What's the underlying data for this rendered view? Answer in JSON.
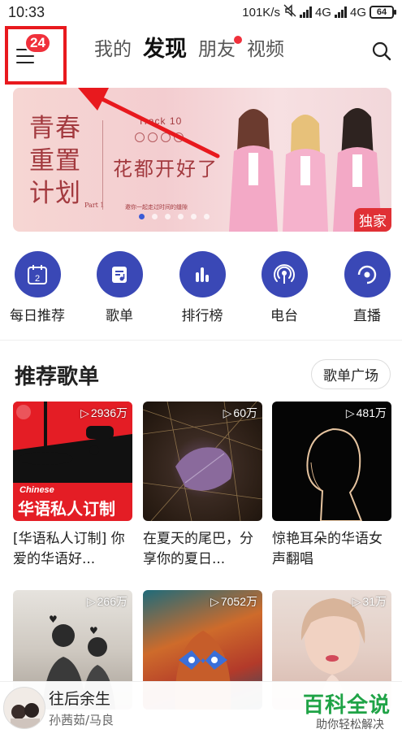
{
  "status_bar": {
    "time": "10:33",
    "network_speed": "101K/s",
    "network_1": "4G",
    "network_2": "4G",
    "battery": "64"
  },
  "top_nav": {
    "menu_badge": "24",
    "tabs": [
      {
        "label": "我的",
        "active": false,
        "dot": false
      },
      {
        "label": "发现",
        "active": true,
        "dot": false
      },
      {
        "label": "朋友",
        "active": false,
        "dot": true
      },
      {
        "label": "视频",
        "active": false,
        "dot": false
      }
    ]
  },
  "banner": {
    "title_lines": [
      "青春",
      "重置",
      "计划"
    ],
    "track": "Track 10",
    "part": "Part 1",
    "headline": "花都开好了",
    "subline": "邀你一起走过时间的缝隙",
    "tag": "独家",
    "page_count": 6,
    "active_index": 0
  },
  "quick_actions": [
    {
      "label": "每日推荐",
      "icon": "calendar-icon",
      "day": "2"
    },
    {
      "label": "歌单",
      "icon": "playlist-icon"
    },
    {
      "label": "排行榜",
      "icon": "chart-bars-icon"
    },
    {
      "label": "电台",
      "icon": "radio-icon"
    },
    {
      "label": "直播",
      "icon": "live-icon"
    }
  ],
  "section": {
    "title": "推荐歌单",
    "more_button": "歌单广场"
  },
  "playlists": [
    {
      "count": "2936万",
      "title": "[华语私人订制] 你爱的华语好...",
      "cover_tag": "Chinese",
      "cover_text": "华语私人订制"
    },
    {
      "count": "60万",
      "title": "在夏天的尾巴，分享你的夏日..."
    },
    {
      "count": "481万",
      "title": "惊艳耳朵的华语女声翻唱"
    },
    {
      "count": "266万",
      "title": ""
    },
    {
      "count": "7052万",
      "title": ""
    },
    {
      "count": "31万",
      "title": ""
    }
  ],
  "player": {
    "song": "往后余生",
    "artist": "孙茜茹/马良"
  },
  "watermark": {
    "title": "百科全说",
    "subtitle": "助你轻松解决"
  },
  "colors": {
    "accent_blue": "#3a48b6",
    "badge_red": "#f0303b",
    "highlight_box": "#e8191e",
    "watermark_green": "#1fa346"
  }
}
